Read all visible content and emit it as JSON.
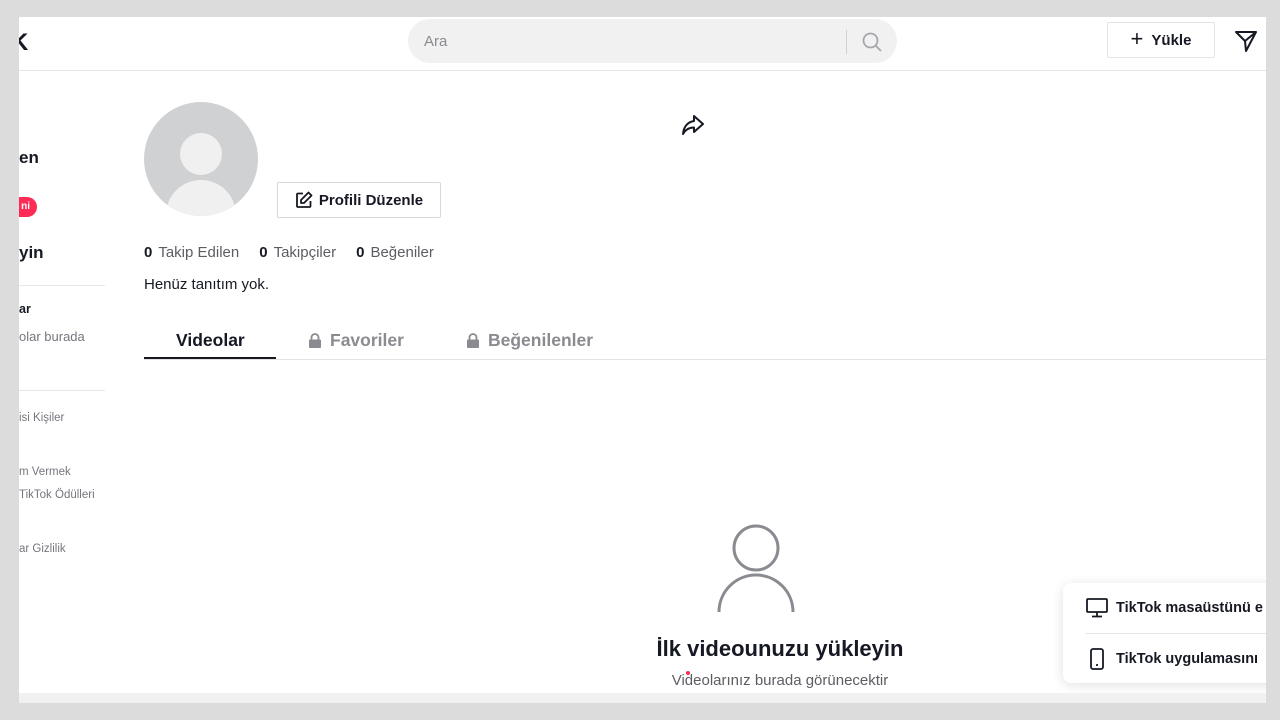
{
  "header": {
    "logo_fragment": "K",
    "search_placeholder": "Ara",
    "upload_label": "Yükle"
  },
  "sidebar": {
    "item_following": "en",
    "badge": "ni",
    "login_prompt": "yin",
    "section1_title": "ar",
    "section1_text": "olar burada",
    "footer_line1": "isi  Kişiler",
    "footer_line2": "m Vermek",
    "footer_line3": "TikTok Ödülleri",
    "footer_line4": "ar  Gizlilik"
  },
  "profile": {
    "edit_button": "Profili Düzenle",
    "stats": [
      {
        "value": "0",
        "label": "Takip Edilen"
      },
      {
        "value": "0",
        "label": "Takipçiler"
      },
      {
        "value": "0",
        "label": "Beğeniler"
      }
    ],
    "bio": "Henüz tanıtım yok."
  },
  "tabs": [
    {
      "label": "Videolar",
      "active": true,
      "locked": false
    },
    {
      "label": "Favoriler",
      "active": false,
      "locked": true
    },
    {
      "label": "Beğenilenler",
      "active": false,
      "locked": true
    }
  ],
  "empty_state": {
    "title": "İlk videounuzu yükleyin",
    "subtitle": "Videolarınız burada görünecektir"
  },
  "promo": {
    "desktop": "TikTok masaüstünü e",
    "app": "TikTok uygulamasını"
  },
  "colors": {
    "accent": "#fe2c55",
    "text": "#161823",
    "muted": "#8a8b91"
  }
}
